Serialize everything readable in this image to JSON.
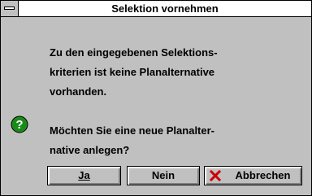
{
  "window": {
    "title": "Selektion vornehmen"
  },
  "message": {
    "lines1": [
      "Zu den eingegebenen Selektions-",
      "kriterien ist keine Planalternative",
      "vorhanden."
    ],
    "lines2": [
      "Möchten Sie eine neue Planalter-",
      "native anlegen?"
    ]
  },
  "buttons": {
    "yes": "Ja",
    "no": "Nein",
    "cancel": "Abbrechen"
  },
  "icons": {
    "message": "question-icon",
    "cancel": "red-x-icon",
    "system": "system-menu-icon"
  },
  "colors": {
    "question_green": "#1a8a1a",
    "cancel_red": "#cc0000",
    "dialog_gray": "#c0c0c0"
  }
}
